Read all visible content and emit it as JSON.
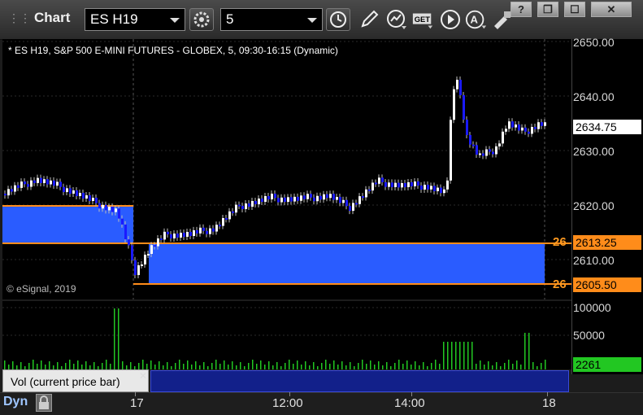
{
  "window": {
    "title": "Chart",
    "symbol": "ES H19",
    "interval": "5",
    "buttons": [
      "?",
      "❐",
      "☐",
      "✕"
    ]
  },
  "toolbar": {
    "icons": [
      "settings-gear-icon",
      "clock-icon",
      "pencil-icon",
      "studies-icon",
      "get-icon",
      "play-icon",
      "a-alert-icon",
      "tools-icon"
    ]
  },
  "chart": {
    "header": "* ES H19, S&P 500 E-MINI FUTURES - GLOBEX, 5, 09:30-16:15 (Dynamic)",
    "copyright": "© eSignal, 2019",
    "price_ticks": [
      "2650.00",
      "2640.00",
      "2630.00",
      "2620.00",
      "2610.00"
    ],
    "last_price": "2634.75",
    "level_upper": "2613.25",
    "level_lower": "2605.50",
    "level_upper_short": "26",
    "level_lower_short": "26",
    "colors": {
      "up": "#ffffff",
      "down": "#1a1aff",
      "zone": "#2a5cff",
      "zone_line": "#ff8c1a",
      "last_price_bg": "#ffffff"
    }
  },
  "volume": {
    "ticks": [
      "100000",
      "50000"
    ],
    "last": "2261",
    "label": "Vol (current price bar)",
    "colors": {
      "up": "#22c722",
      "down": "#d02020",
      "last_bg": "#22c722"
    }
  },
  "footer": {
    "mode": "Dyn",
    "time_labels": [
      "17",
      "12:00",
      "14:00",
      "18"
    ]
  }
}
